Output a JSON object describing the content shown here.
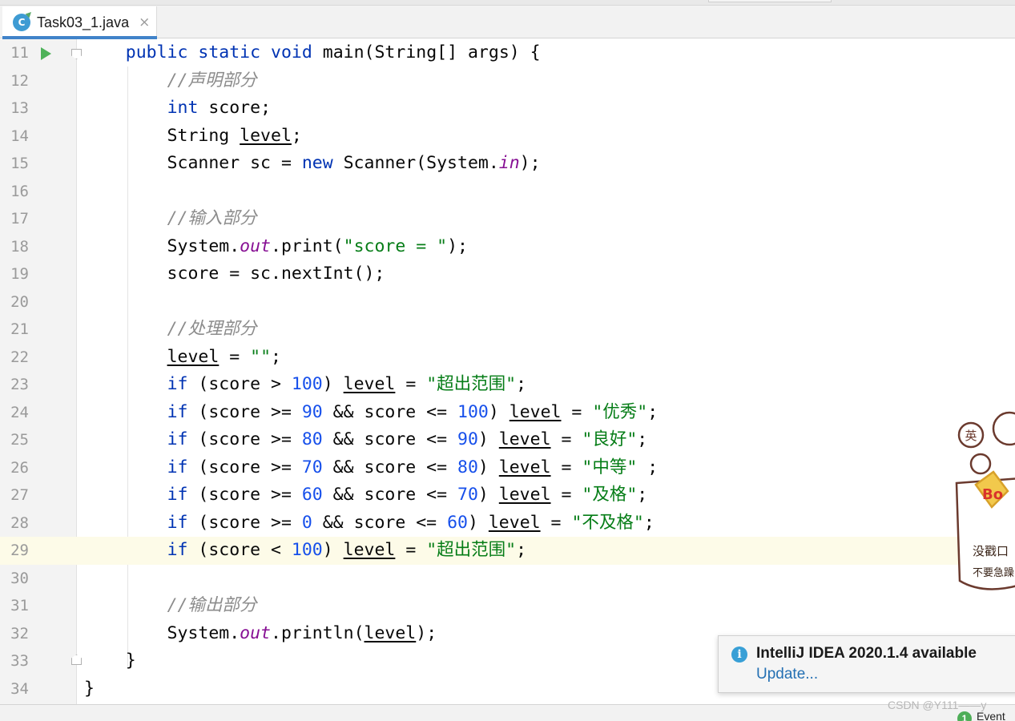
{
  "tab": {
    "filename": "Task03_1.java",
    "close_glyph": "×",
    "icon": "java-class-icon",
    "icon_letter": "C"
  },
  "editor": {
    "current_line": 29,
    "lines": [
      {
        "n": "11",
        "tokens": [
          [
            "",
            "    "
          ],
          [
            "kw",
            "public"
          ],
          [
            "",
            " "
          ],
          [
            "kw",
            "static"
          ],
          [
            "",
            " "
          ],
          [
            "kw",
            "void"
          ],
          [
            "",
            " "
          ],
          [
            "method",
            "main"
          ],
          [
            "",
            "(String[] args) {"
          ]
        ]
      },
      {
        "n": "12",
        "tokens": [
          [
            "",
            "        "
          ],
          [
            "cm",
            "//声明部分"
          ]
        ]
      },
      {
        "n": "13",
        "tokens": [
          [
            "",
            "        "
          ],
          [
            "kw",
            "int"
          ],
          [
            "",
            " score;"
          ]
        ]
      },
      {
        "n": "14",
        "tokens": [
          [
            "",
            "        String "
          ],
          [
            "var",
            "level"
          ],
          [
            "",
            ";"
          ]
        ]
      },
      {
        "n": "15",
        "tokens": [
          [
            "",
            "        Scanner sc = "
          ],
          [
            "kw",
            "new"
          ],
          [
            "",
            " Scanner(System."
          ],
          [
            "fld",
            "in"
          ],
          [
            "",
            ");"
          ]
        ]
      },
      {
        "n": "16",
        "tokens": []
      },
      {
        "n": "17",
        "tokens": [
          [
            "",
            "        "
          ],
          [
            "cm",
            "//输入部分"
          ]
        ]
      },
      {
        "n": "18",
        "tokens": [
          [
            "",
            "        System."
          ],
          [
            "fld",
            "out"
          ],
          [
            "",
            ".print("
          ],
          [
            "str",
            "\"score = \""
          ],
          [
            "",
            ");"
          ]
        ]
      },
      {
        "n": "19",
        "tokens": [
          [
            "",
            "        score = sc.nextInt();"
          ]
        ]
      },
      {
        "n": "20",
        "tokens": []
      },
      {
        "n": "21",
        "tokens": [
          [
            "",
            "        "
          ],
          [
            "cm",
            "//处理部分"
          ]
        ]
      },
      {
        "n": "22",
        "tokens": [
          [
            "",
            "        "
          ],
          [
            "var",
            "level"
          ],
          [
            "",
            " = "
          ],
          [
            "str",
            "\"\""
          ],
          [
            "",
            ";"
          ]
        ]
      },
      {
        "n": "23",
        "tokens": [
          [
            "",
            "        "
          ],
          [
            "kw",
            "if"
          ],
          [
            "",
            " (score > "
          ],
          [
            "num",
            "100"
          ],
          [
            "",
            ") "
          ],
          [
            "var",
            "level"
          ],
          [
            "",
            " = "
          ],
          [
            "str",
            "\"超出范围\""
          ],
          [
            "",
            ";"
          ]
        ]
      },
      {
        "n": "24",
        "tokens": [
          [
            "",
            "        "
          ],
          [
            "kw",
            "if"
          ],
          [
            "",
            " (score >= "
          ],
          [
            "num",
            "90"
          ],
          [
            "",
            " && score <= "
          ],
          [
            "num",
            "100"
          ],
          [
            "",
            ") "
          ],
          [
            "var",
            "level"
          ],
          [
            "",
            " = "
          ],
          [
            "str",
            "\"优秀\""
          ],
          [
            "",
            ";"
          ]
        ]
      },
      {
        "n": "25",
        "tokens": [
          [
            "",
            "        "
          ],
          [
            "kw",
            "if"
          ],
          [
            "",
            " (score >= "
          ],
          [
            "num",
            "80"
          ],
          [
            "",
            " && score <= "
          ],
          [
            "num",
            "90"
          ],
          [
            "",
            ") "
          ],
          [
            "var",
            "level"
          ],
          [
            "",
            " = "
          ],
          [
            "str",
            "\"良好\""
          ],
          [
            "",
            ";"
          ]
        ]
      },
      {
        "n": "26",
        "tokens": [
          [
            "",
            "        "
          ],
          [
            "kw",
            "if"
          ],
          [
            "",
            " (score >= "
          ],
          [
            "num",
            "70"
          ],
          [
            "",
            " && score <= "
          ],
          [
            "num",
            "80"
          ],
          [
            "",
            ") "
          ],
          [
            "var",
            "level"
          ],
          [
            "",
            " = "
          ],
          [
            "str",
            "\"中等\""
          ],
          [
            "",
            " ;"
          ]
        ]
      },
      {
        "n": "27",
        "tokens": [
          [
            "",
            "        "
          ],
          [
            "kw",
            "if"
          ],
          [
            "",
            " (score >= "
          ],
          [
            "num",
            "60"
          ],
          [
            "",
            " && score <= "
          ],
          [
            "num",
            "70"
          ],
          [
            "",
            ") "
          ],
          [
            "var",
            "level"
          ],
          [
            "",
            " = "
          ],
          [
            "str",
            "\"及格\""
          ],
          [
            "",
            ";"
          ]
        ]
      },
      {
        "n": "28",
        "tokens": [
          [
            "",
            "        "
          ],
          [
            "kw",
            "if"
          ],
          [
            "",
            " (score >= "
          ],
          [
            "num",
            "0"
          ],
          [
            "",
            " && score <= "
          ],
          [
            "num",
            "60"
          ],
          [
            "",
            ") "
          ],
          [
            "var",
            "level"
          ],
          [
            "",
            " = "
          ],
          [
            "str",
            "\"不及格\""
          ],
          [
            "",
            ";"
          ]
        ]
      },
      {
        "n": "29",
        "tokens": [
          [
            "",
            "        "
          ],
          [
            "kw",
            "if"
          ],
          [
            "",
            " (score < "
          ],
          [
            "num",
            "100"
          ],
          [
            "",
            ") "
          ],
          [
            "var",
            "level"
          ],
          [
            "",
            " = "
          ],
          [
            "str",
            "\"超出范围\""
          ],
          [
            "",
            ";"
          ]
        ]
      },
      {
        "n": "30",
        "tokens": []
      },
      {
        "n": "31",
        "tokens": [
          [
            "",
            "        "
          ],
          [
            "cm",
            "//输出部分"
          ]
        ]
      },
      {
        "n": "32",
        "tokens": [
          [
            "",
            "        System."
          ],
          [
            "fld",
            "out"
          ],
          [
            "",
            ".println("
          ],
          [
            "var",
            "level"
          ],
          [
            "",
            ");"
          ]
        ]
      },
      {
        "n": "33",
        "tokens": [
          [
            "",
            "    }"
          ]
        ]
      },
      {
        "n": "34",
        "tokens": [
          [
            "",
            "}"
          ]
        ]
      }
    ]
  },
  "notification": {
    "icon": "info-icon",
    "title": "IntelliJ IDEA 2020.1.4 available",
    "link": "Update..."
  },
  "watermark": "CSDN @Y111——y",
  "status": {
    "event_count": "1",
    "event_label": "Event"
  },
  "sticker": {
    "icon": "cartoon-sticker",
    "badge_text": "英",
    "line1": "没戳口",
    "line2": "不要急躁"
  },
  "colors": {
    "keyword": "#0033b3",
    "number": "#1750eb",
    "string": "#067d17",
    "comment": "#8c8c8c",
    "field": "#871094",
    "caret_row": "#fdfbe8"
  }
}
